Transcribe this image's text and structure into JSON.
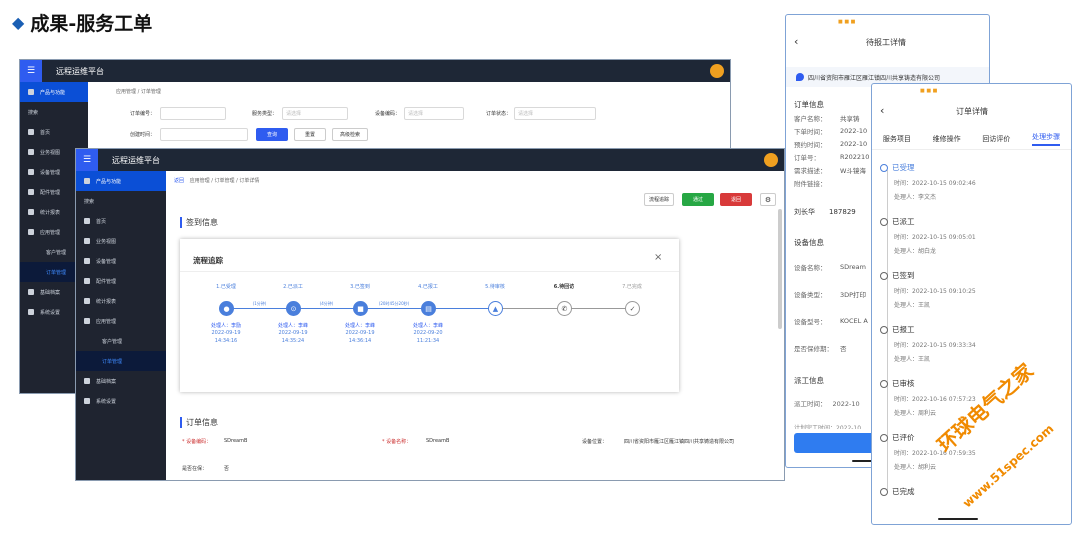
{
  "slide_title": "成果-服务工单",
  "brand": "远程运维平台",
  "back_window": {
    "breadcrumb": "应用管理 / 订单管理",
    "sidebar": {
      "top": "产品与功能",
      "search": "搜索",
      "items": [
        "首页",
        "业务视图",
        "设备管理",
        "配件管理",
        "统计报表",
        "应用管理",
        "客户管理",
        "订单管理",
        "基础档案",
        "系统设置"
      ]
    },
    "filters": {
      "order_no": "订单编号：",
      "service_type": "服务类型：",
      "service_ph": "请选择",
      "device_code": "设备编码：",
      "device_ph": "请选择",
      "order_status": "订单状态：",
      "status_ph": "请选择",
      "created": "创建时间："
    },
    "buttons": {
      "query": "查询",
      "reset": "重置",
      "advanced": "高级检索"
    }
  },
  "front_window": {
    "breadcrumb": "应用管理 / 订单管理 / 订单详情",
    "back": "返回",
    "sidebar": {
      "top": "产品与功能",
      "search": "搜索",
      "items": [
        "首页",
        "业务视图",
        "设备管理",
        "配件管理",
        "统计报表",
        "应用管理",
        "客户管理",
        "订单管理",
        "基础档案",
        "系统设置"
      ]
    },
    "actions": {
      "flow": "流程追踪",
      "pass": "通过",
      "reject": "退回"
    },
    "sign_section": "签到信息",
    "order_section": "订单信息",
    "order_fields": {
      "code_k": "* 设备编码：",
      "code_v": "SDreamB",
      "name_k": "* 设备名称：",
      "name_v": "SDreamB",
      "loc_k": "设备位置：",
      "loc_v": "四川省资阳市雁江区雁江镇四川共享铸造有限公司",
      "warranty_k": "是否在保：",
      "warranty_v": "否"
    },
    "modal": {
      "title": "流程追踪",
      "close": "×",
      "steps": [
        {
          "label": "1.已受理",
          "person": "处理人：李励",
          "date": "2022-09-19",
          "time": "14:34:16"
        },
        {
          "label": "2.已派工",
          "person": "处理人：李峰",
          "date": "2022-09-19",
          "time": "14:35:24"
        },
        {
          "label": "3.已签到",
          "person": "处理人：李峰",
          "date": "2022-09-19",
          "time": "14:36:14"
        },
        {
          "label": "4.已报工",
          "person": "处理人：李峰",
          "date": "2022-09-20",
          "time": "11:21:34"
        },
        {
          "label": "5.待审核",
          "person": "",
          "date": "",
          "time": ""
        },
        {
          "label": "6.待回访",
          "person": "",
          "date": "",
          "time": ""
        },
        {
          "label": "7.已完成",
          "person": "",
          "date": "",
          "time": ""
        }
      ],
      "connectors": [
        "(1分钟)",
        "(4分钟)",
        "(20时45分20秒)"
      ]
    }
  },
  "phone_back": {
    "title": "待报工详情",
    "location": "四川省资阳市雁江区雁江镇四川共享铸造有限公司",
    "section1": "订单信息",
    "rows": [
      [
        "客户名称：",
        "共享铸"
      ],
      [
        "下单时间：",
        "2022-10"
      ],
      [
        "预约时间：",
        "2022-10"
      ],
      [
        "订单号：",
        "R202210"
      ],
      [
        "需求描述：",
        "W斗镜海"
      ],
      [
        "附件链接：",
        ""
      ]
    ],
    "contact_name": "刘长华",
    "contact_phone": "187829",
    "section2": "设备信息",
    "dev_rows": [
      [
        "设备名称：",
        "SDream"
      ],
      [
        "设备类型：",
        "3DP打印"
      ],
      [
        "设备型号：",
        "KOCEL A"
      ],
      [
        "是否保修期：",
        "否"
      ]
    ],
    "section3": "派工信息",
    "dispatch_k": "派工时间：",
    "dispatch_v": "2022-10",
    "partial": "计划完工时间：2022-10"
  },
  "phone_front": {
    "title": "订单详情",
    "tabs": [
      "服务项目",
      "维修操作",
      "回访评价",
      "处理步骤"
    ],
    "timeline": [
      {
        "status": "已受理",
        "time": "时间：2022-10-15 09:02:46",
        "person": "处理人：李文杰"
      },
      {
        "status": "已派工",
        "time": "时间：2022-10-15 09:05:01",
        "person": "处理人：胡白龙"
      },
      {
        "status": "已签到",
        "time": "时间：2022-10-15 09:10:25",
        "person": "处理人：王凯"
      },
      {
        "status": "已报工",
        "time": "时间：2022-10-15 09:33:34",
        "person": "处理人：王凯"
      },
      {
        "status": "已审核",
        "time": "时间：2022-10-16 07:57:23",
        "person": "处理人：周利云"
      },
      {
        "status": "已评价",
        "time": "时间：2022-10-16 07:59:35",
        "person": "处理人：胡利云"
      },
      {
        "status": "已完成",
        "time": "",
        "person": ""
      }
    ]
  },
  "watermark": {
    "cn": "环球电气之家",
    "url": "www.51spec.com"
  }
}
